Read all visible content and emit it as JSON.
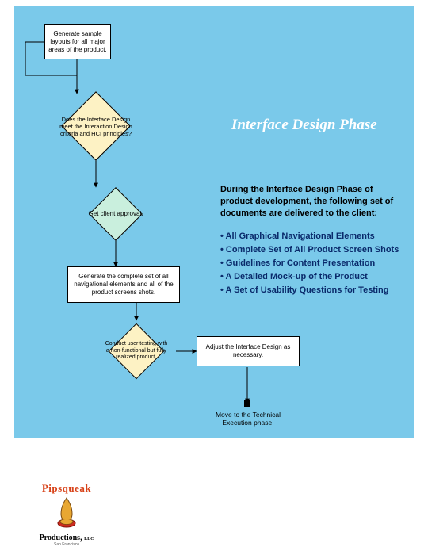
{
  "title": "Interface Design Phase",
  "intro": "During the Interface Design Phase of product development, the following set of documents are delivered to the client:",
  "deliverables": [
    "All Graphical Navigational Elements",
    "Complete Set of All Product Screen Shots",
    "Guidelines for Content Presentation",
    "A Detailed Mock-up of the Product",
    "A Set of Usability Questions for Testing"
  ],
  "nodes": {
    "n1": "Generate sample layouts for all major areas of the product.",
    "n2": "Does the Interface Design meet the Interaction Design criteria and HCI principles?",
    "n3": "Get client approval.",
    "n4": "Generate the complete set of all navigational elements and all of the product screens shots.",
    "n5": "Conduct user testing with a non-functional but fully realized product.",
    "n6": "Adjust the Interface Design as necessary.",
    "n7": "Move to the Technical Execution phase."
  },
  "logo": {
    "top": "Pipsqueak",
    "bottom": "Productions,",
    "suffix": "LLC",
    "tagline": "San Francisco"
  }
}
